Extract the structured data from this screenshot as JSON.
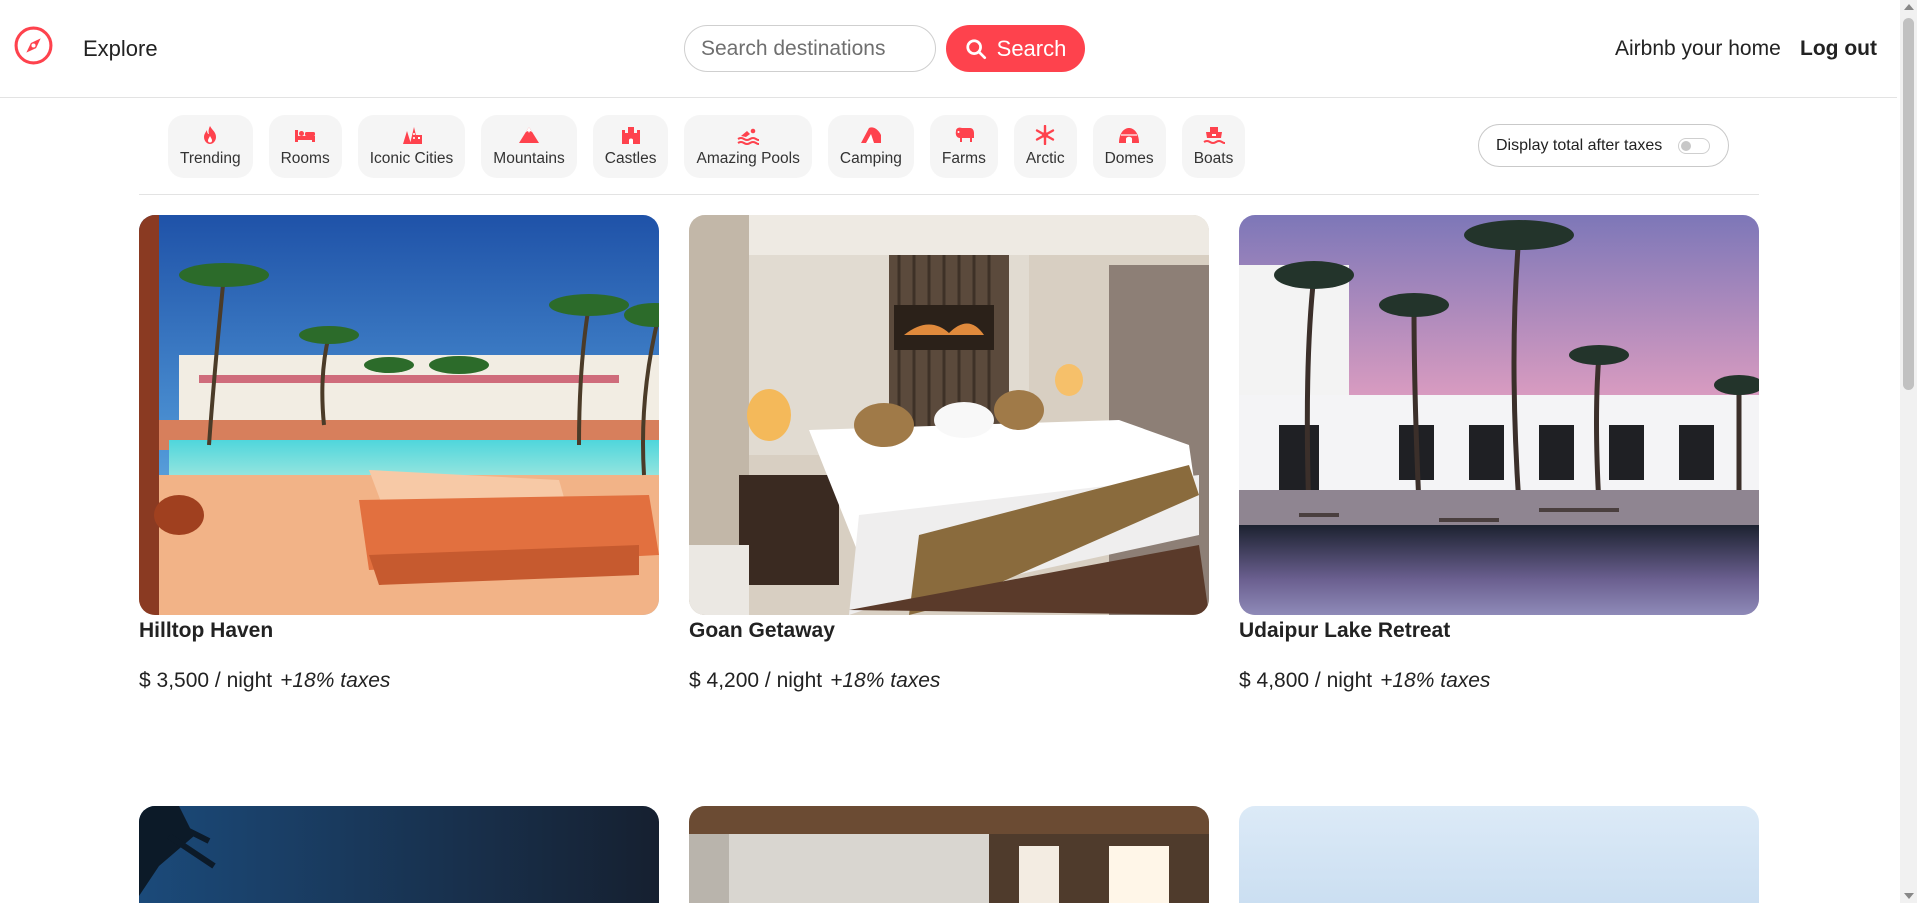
{
  "header": {
    "explore_label": "Explore",
    "search_placeholder": "Search destinations",
    "search_button_label": "Search",
    "host_link_label": "Airbnb your home",
    "logout_label": "Log out",
    "accent_color": "#fe424d"
  },
  "filters": [
    {
      "label": "Trending",
      "icon": "fire-icon"
    },
    {
      "label": "Rooms",
      "icon": "bed-icon"
    },
    {
      "label": "Iconic Cities",
      "icon": "city-icon"
    },
    {
      "label": "Mountains",
      "icon": "mountain-icon"
    },
    {
      "label": "Castles",
      "icon": "castle-icon"
    },
    {
      "label": "Amazing Pools",
      "icon": "swimmer-icon"
    },
    {
      "label": "Camping",
      "icon": "tent-icon"
    },
    {
      "label": "Farms",
      "icon": "cow-icon"
    },
    {
      "label": "Arctic",
      "icon": "snowflake-icon"
    },
    {
      "label": "Domes",
      "icon": "igloo-icon"
    },
    {
      "label": "Boats",
      "icon": "ship-icon"
    }
  ],
  "tax_toggle": {
    "label": "Display total after taxes",
    "enabled": false
  },
  "listings": [
    {
      "title": "Hilltop Haven",
      "price": "$ 3,500 / night",
      "tax_note": "+18% taxes"
    },
    {
      "title": "Goan Getaway",
      "price": "$ 4,200 / night",
      "tax_note": "+18% taxes"
    },
    {
      "title": "Udaipur Lake Retreat",
      "price": "$ 4,800 / night",
      "tax_note": "+18% taxes"
    }
  ]
}
